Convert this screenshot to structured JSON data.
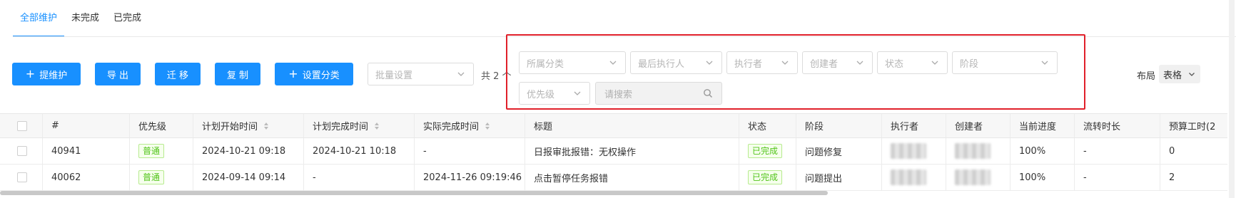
{
  "tabs": [
    {
      "label": "全部维护",
      "active": true
    },
    {
      "label": "未完成",
      "active": false
    },
    {
      "label": "已完成",
      "active": false
    }
  ],
  "toolbar": {
    "add_label": "提维护",
    "export_label": "导 出",
    "migrate_label": "迁 移",
    "copy_label": "复 制",
    "set_category_label": "设置分类",
    "batch_placeholder": "批量设置",
    "total_text": "共 2 个"
  },
  "filters": {
    "category": "所属分类",
    "last_executor": "最后执行人",
    "executor": "执行者",
    "creator": "创建者",
    "status": "状态",
    "stage": "阶段",
    "priority": "优先级",
    "search_placeholder": "请搜索"
  },
  "layout": {
    "label": "布局",
    "value": "表格"
  },
  "table": {
    "headers": {
      "id": "#",
      "priority": "优先级",
      "plan_start": "计划开始时间",
      "plan_finish": "计划完成时间",
      "actual_finish": "实际完成时间",
      "title": "标题",
      "status": "状态",
      "stage": "阶段",
      "executor": "执行者",
      "creator": "创建者",
      "progress": "当前进度",
      "flow_time": "流转时长",
      "budget_hours": "预算工时(2"
    },
    "rows": [
      {
        "id": "40941",
        "priority": "普通",
        "plan_start": "2024-10-21 09:18",
        "plan_finish": "2024-10-21 10:18",
        "actual_finish": "-",
        "title": "日报审批报错：无权操作",
        "status": "已完成",
        "stage": "问题修复",
        "progress": "100%",
        "flow_time": "-",
        "budget_hours": "0"
      },
      {
        "id": "40062",
        "priority": "普通",
        "plan_start": "2024-09-14 09:14",
        "plan_finish": "-",
        "actual_finish": "2024-11-26 09:19:46",
        "title": "点击暂停任务报错",
        "status": "已完成",
        "stage": "问题提出",
        "progress": "100%",
        "flow_time": "-",
        "budget_hours": "2"
      }
    ]
  },
  "colors": {
    "primary": "#1890ff",
    "highlight_border": "#e0202a",
    "tag_green": "#52c41a"
  },
  "icons": [
    "plus-icon",
    "chevron-down-icon",
    "search-icon",
    "sort-icon"
  ]
}
